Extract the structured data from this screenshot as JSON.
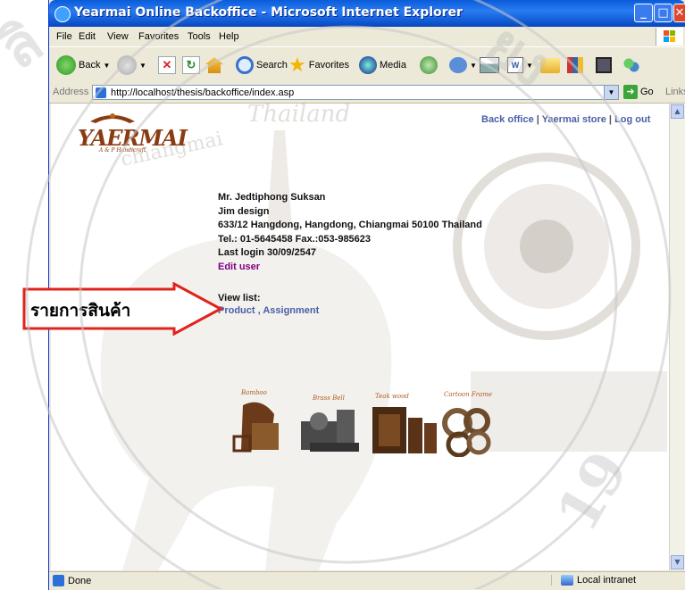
{
  "window": {
    "title": "Yearmai Online Backoffice - Microsoft Internet Explorer",
    "min_btn": "_",
    "max_btn": "□",
    "close_btn": "✕"
  },
  "menu": {
    "items": [
      "File",
      "Edit",
      "View",
      "Favorites",
      "Tools",
      "Help"
    ]
  },
  "toolbar": {
    "back": "Back",
    "search": "Search",
    "favorites": "Favorites",
    "media": "Media"
  },
  "address": {
    "label": "Address",
    "url": "http://localhost/thesis/backoffice/index.asp",
    "go": "Go",
    "links": "Links"
  },
  "page": {
    "logo": "YAERMAI",
    "logo_sub": "A & P Handicraft",
    "nav": {
      "back_office": "Back office",
      "store": "Yaermai store",
      "logout": "Log out",
      "sep": " | "
    },
    "user": {
      "name": "Mr. Jedtiphong Suksan",
      "company": "Jim design",
      "address": "633/12 Hangdong, Hangdong, Chiangmai 50100 Thailand",
      "phone": "Tel.: 01-5645458 Fax.:053-985623",
      "last_login": "Last login 30/09/2547",
      "edit": "Edit user"
    },
    "view_list": {
      "label": "View list:",
      "product": "Product",
      "sep": " , ",
      "assignment": "Assignment"
    },
    "product_labels": [
      "Bamboo",
      "Brass Bell",
      "Teak wood",
      "Cartoon Frame"
    ]
  },
  "callout": {
    "text": "รายการสินค้า",
    "border_color": "#e0241b"
  },
  "status": {
    "left": "Done",
    "zone": "Local intranet"
  }
}
